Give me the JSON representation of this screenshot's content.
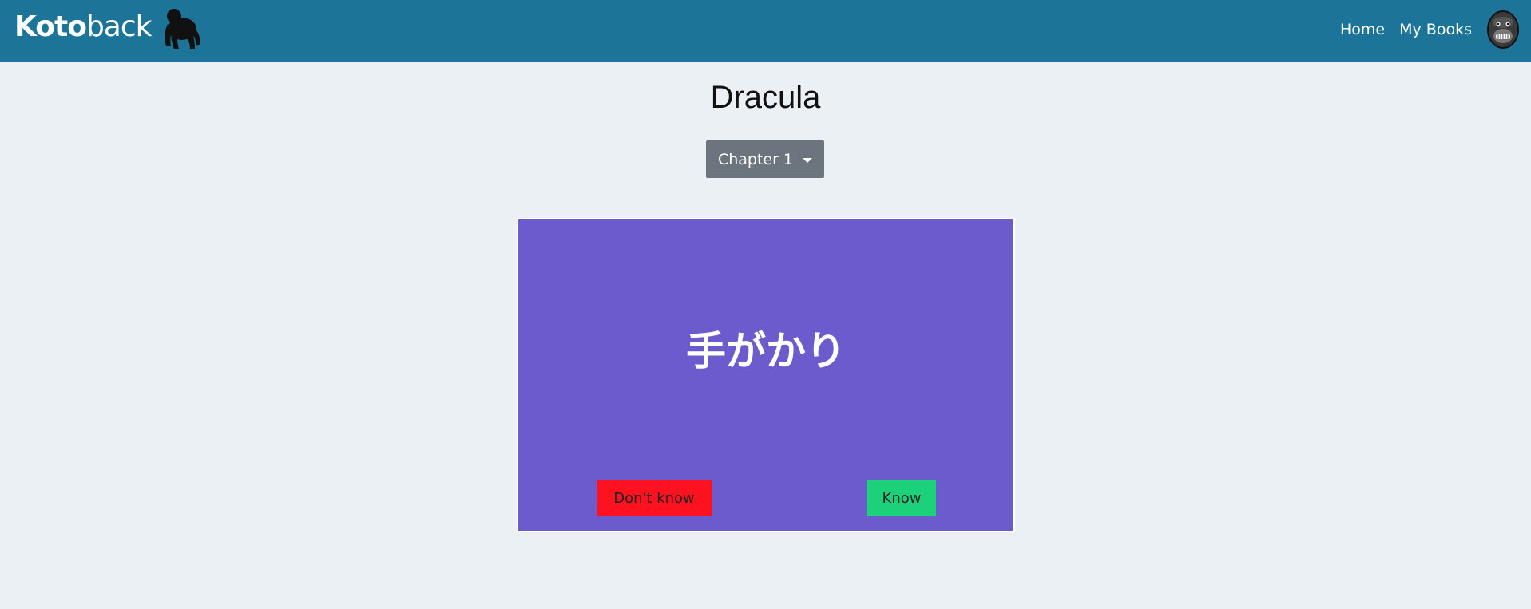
{
  "navbar": {
    "brand_bold": "Koto",
    "brand_light": "back",
    "brand_icon": "gorilla-icon",
    "links": [
      "Home",
      "My Books"
    ],
    "avatar_icon": "gorilla-face-avatar",
    "bg_color": "#1c7598"
  },
  "book": {
    "title": "Dracula",
    "chapter_selected": "Chapter 1"
  },
  "flashcard": {
    "word": "手がかり",
    "dont_know_label": "Don't know",
    "know_label": "Know",
    "card_color": "#6c5bcd",
    "dont_know_color": "#fe121f",
    "know_color": "#1bd27a"
  }
}
